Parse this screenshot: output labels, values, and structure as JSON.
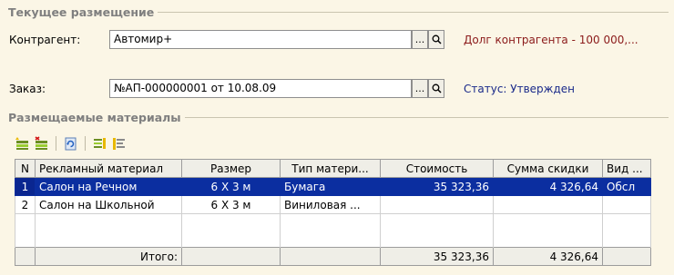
{
  "groups": {
    "placement": "Текущее размещение",
    "materials": "Размещаемые материалы"
  },
  "contractor": {
    "label": "Контрагент:",
    "value": "Автомир+",
    "debt": "Долг контрагента - 100 000,..."
  },
  "order": {
    "label": "Заказ:",
    "value": "№АП-000000001 от 10.08.09",
    "status": "Статус: Утвержден"
  },
  "field_buttons": {
    "select": "...",
    "open": "Q"
  },
  "colors": {
    "selected_row": "#0b2ea0",
    "debt_text": "#8b1a1a",
    "status_text": "#1a2a8a"
  },
  "toolbar": [
    "add-row-icon",
    "delete-row-icon",
    "refresh-icon",
    "fill-icon",
    "list-icon"
  ],
  "table": {
    "headers": [
      "N",
      "Рекламный материал",
      "Размер",
      "Тип матери...",
      "Стоимость",
      "Сумма скидки",
      "Вид ..."
    ],
    "rows": [
      [
        "1",
        "Салон на Речном",
        "6 X 3 м",
        "Бумага",
        "35 323,36",
        "4 326,64",
        "Обсл"
      ],
      [
        "2",
        "Салон на Школьной",
        "6 X 3 м",
        "Виниловая ...",
        "",
        "",
        ""
      ]
    ],
    "total": {
      "label": "Итого:",
      "cost": "35 323,36",
      "discount": "4 326,64"
    }
  }
}
